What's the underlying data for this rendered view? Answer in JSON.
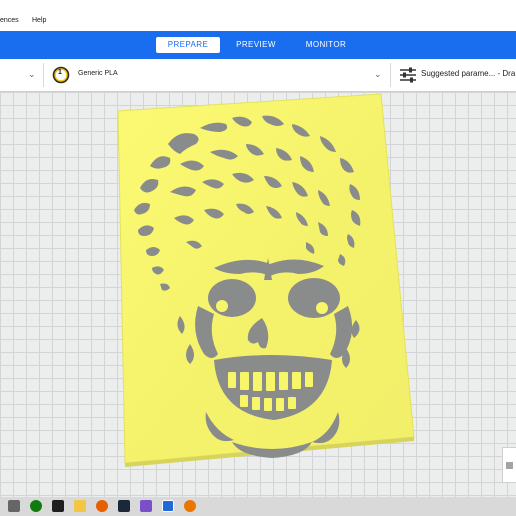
{
  "menu": {
    "items": [
      "ences",
      "Help"
    ]
  },
  "stages": [
    {
      "label": "PREPARE",
      "active": true
    },
    {
      "label": "PREVIEW",
      "active": false
    },
    {
      "label": "MONITOR",
      "active": false
    }
  ],
  "toolbar": {
    "extruder_number": "1",
    "material": "Generic PLA",
    "print_settings": "Suggested parame... - Dra"
  },
  "colors": {
    "accent": "#196ef0",
    "model_yellow": "#f7f56a",
    "model_cutout": "#8a8c8c"
  },
  "taskbar": {
    "icons": [
      "windows-start-icon",
      "xbox-icon",
      "media-icon",
      "file-explorer-icon",
      "firefox-icon",
      "steam-icon",
      "app-icon",
      "ultimaker-cura-icon",
      "blender-icon"
    ]
  }
}
